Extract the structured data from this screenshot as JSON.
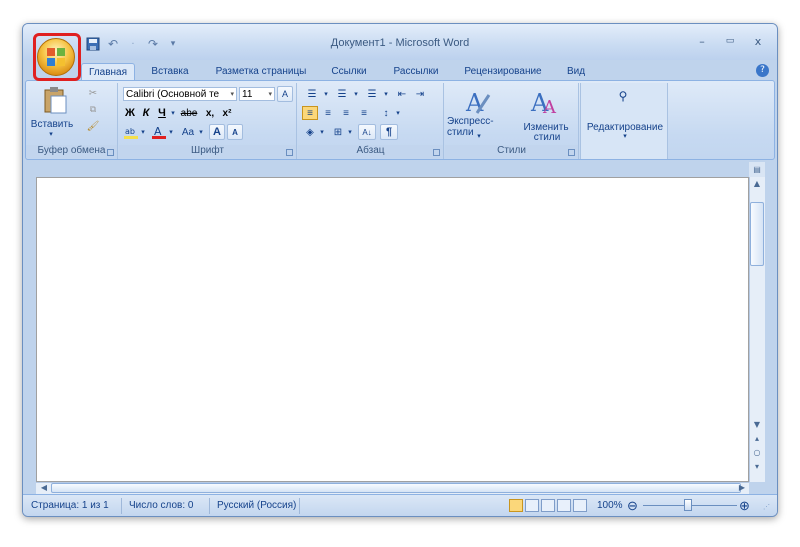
{
  "window": {
    "title": "Документ1 - Microsoft Word",
    "controls": {
      "minimize": "–",
      "maximize": "▭",
      "close": "x"
    }
  },
  "qat": {
    "save": "save-icon",
    "undo": "↶",
    "redo": "↷",
    "more": "▾"
  },
  "tabs": [
    "Главная",
    "Вставка",
    "Разметка страницы",
    "Ссылки",
    "Рассылки",
    "Рецензирование",
    "Вид"
  ],
  "help": "?",
  "ribbon": {
    "clipboard": {
      "label": "Буфер обмена",
      "paste": "Вставить",
      "paste_arrow": "▾"
    },
    "font": {
      "label": "Шрифт",
      "font_name": "Calibri (Основной те",
      "font_size": "11",
      "bold": "Ж",
      "italic": "К",
      "underline": "Ч",
      "strike": "abe",
      "subscript": "x,",
      "superscript": "x²",
      "change_case": "Aa",
      "grow": "A",
      "shrink": "A"
    },
    "paragraph": {
      "label": "Абзац",
      "pilcrow": "¶",
      "sort": "А↓"
    },
    "styles": {
      "label": "Стили",
      "quick_styles": "Экспресс-стили",
      "change_styles_1": "Изменить",
      "change_styles_2": "стили"
    },
    "editing": {
      "label": "Редактирование"
    }
  },
  "status": {
    "page": "Страница: 1 из 1",
    "words": "Число слов: 0",
    "language": "Русский (Россия)",
    "zoom": "100%",
    "zoom_minus": "⊖",
    "zoom_plus": "⊕"
  },
  "colors": {
    "accent": "#15428b",
    "highlight_box": "#e02020",
    "highlight_marker": "#f4e04d",
    "font_color_bar": "#e02020"
  }
}
